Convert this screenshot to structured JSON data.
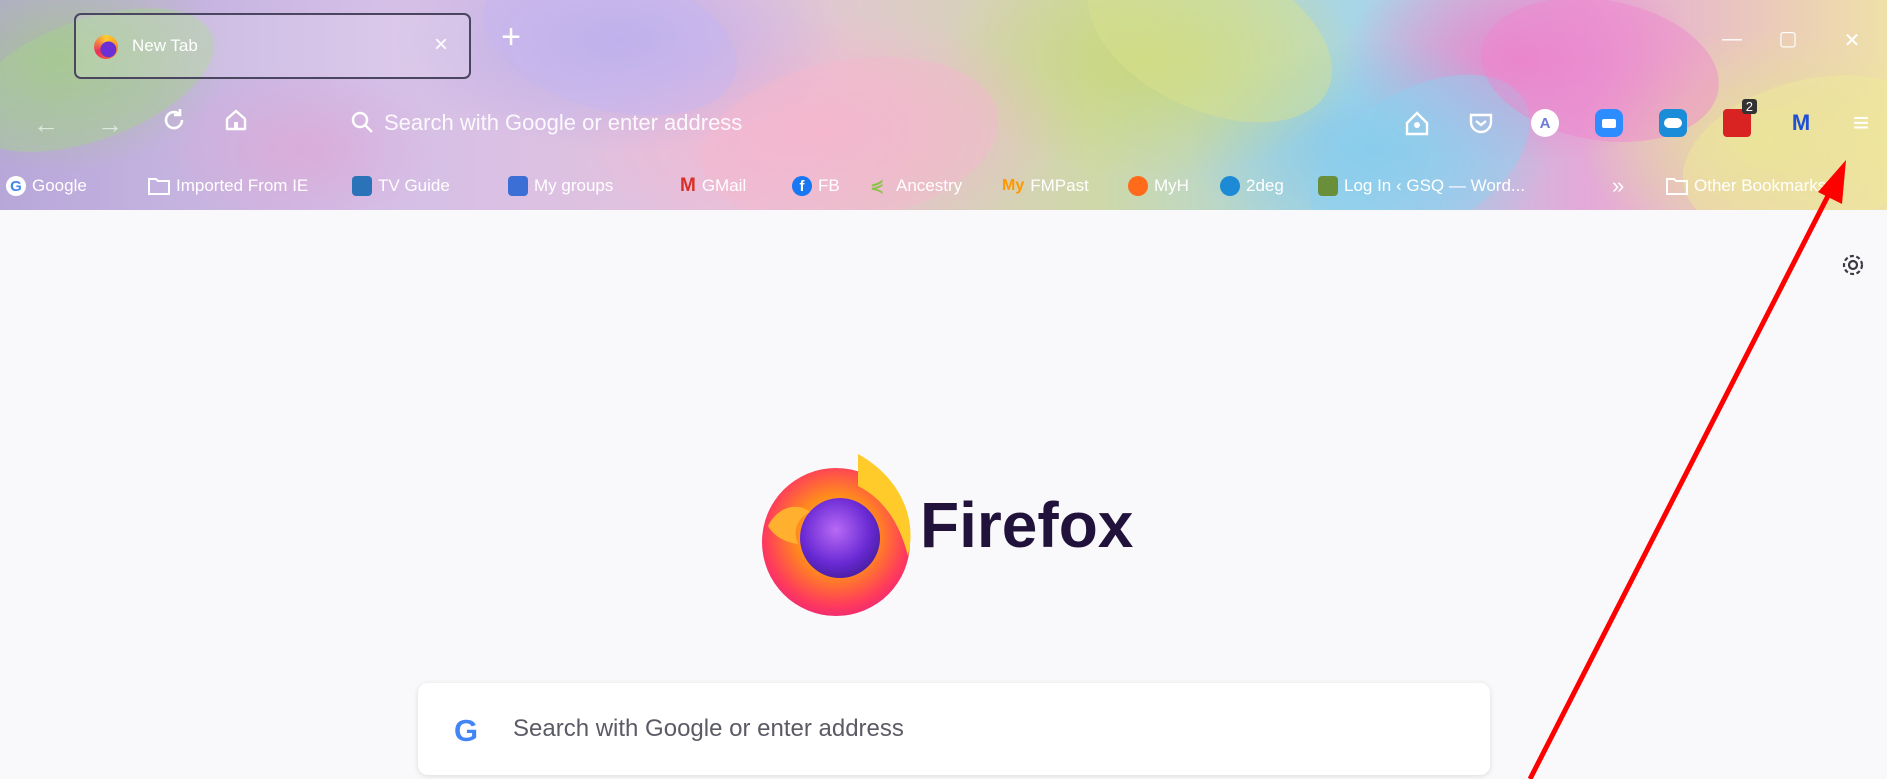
{
  "tab": {
    "title": "New Tab",
    "close": "×"
  },
  "tabstrip": {
    "new_tab": "+"
  },
  "window_controls": {
    "minimize": "—",
    "restore": "▢",
    "close": "✕"
  },
  "navbar": {
    "back": "←",
    "forward": "→",
    "reload": "C",
    "home": "⌂",
    "url_placeholder": "Search with Google or enter address",
    "extensions": [
      {
        "name": "Abb-extension",
        "label": "",
        "color": "#ffffff"
      },
      {
        "name": "pocket",
        "label": "",
        "color": "#ffffff"
      },
      {
        "name": "profile-a",
        "label": "A",
        "color": "#ffffff"
      },
      {
        "name": "zoom",
        "label": "",
        "color": "#2d8cff"
      },
      {
        "name": "cloud",
        "label": "",
        "color": "#1a8cd8"
      },
      {
        "name": "calendar-badge",
        "label": "2",
        "color": "#e02020"
      },
      {
        "name": "malwarebytes",
        "label": "M",
        "color": "#ffffff"
      }
    ],
    "menu": "≡"
  },
  "bookmarks": [
    {
      "label": "Google",
      "icon": "google",
      "color": "#4285f4"
    },
    {
      "label": "Imported From IE",
      "icon": "folder",
      "color": "#ffffff"
    },
    {
      "label": "TV Guide",
      "icon": "tv",
      "color": "#2a73b8"
    },
    {
      "label": "My groups",
      "icon": "groups",
      "color": "#3c6fd6"
    },
    {
      "label": "GMail",
      "icon": "gmail",
      "color": "#d93025"
    },
    {
      "label": "FB",
      "icon": "facebook",
      "color": "#1877f2"
    },
    {
      "label": "Ancestry",
      "icon": "ancestry",
      "color": "#8bc34a"
    },
    {
      "label": "FMPast",
      "icon": "fmpast",
      "color": "#ff9800"
    },
    {
      "label": "MyH",
      "icon": "myh",
      "color": "#ff6b1a"
    },
    {
      "label": "2deg",
      "icon": "2deg",
      "color": "#1d8ad6"
    },
    {
      "label": "Log In ‹ GSQ — Word...",
      "icon": "gsq",
      "color": "#6a8f3a"
    }
  ],
  "bookmarks_overflow": "»",
  "other_bookmarks": "Other Bookmarks",
  "content": {
    "brand": "Firefox",
    "search_placeholder": "Search with Google or enter address",
    "search_logo": "G"
  },
  "colors": {
    "annotation_arrow": "#ff0000",
    "page_background": "#f9f9fb",
    "brand_text": "#20123a"
  }
}
